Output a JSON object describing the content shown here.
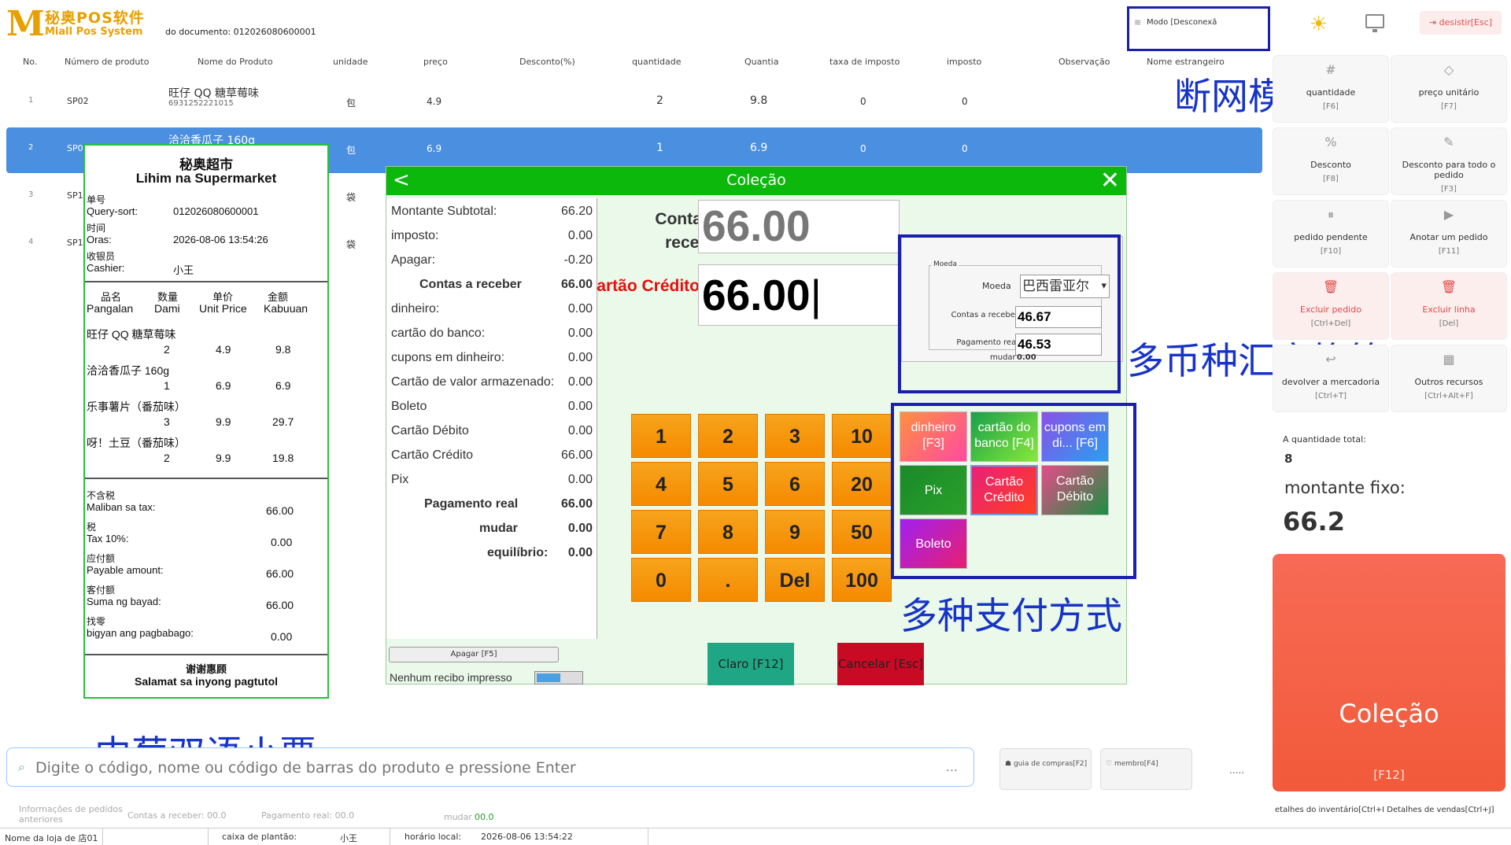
{
  "app": {
    "logo_mark": "M",
    "logo_cn": "秘奥POS软件",
    "logo_en": "Miall Pos System",
    "doc_label": "do documento: 012026080600001"
  },
  "header": {
    "mode": "Modo [Desconexã",
    "exit": "desistir[Esc]"
  },
  "annotations": {
    "offline": "断网模式",
    "currency": "多币种汇率换算",
    "payments": "多种支付方式",
    "receipt": "中葡双语小票"
  },
  "table": {
    "columns": [
      "No.",
      "Número de produto",
      "Nome do Produto",
      "unidade",
      "preço",
      "Desconto(%)",
      "quantidade",
      "Quantia",
      "taxa de imposto",
      "imposto",
      "Observação",
      "Nome estrangeiro"
    ],
    "rows": [
      {
        "no": "1",
        "code": "SP02",
        "name": "旺仔 QQ 糖草莓味",
        "barcode": "6931252221015",
        "unit": "包",
        "price": "4.9",
        "qty": "2",
        "amount": "9.8",
        "rate": "0",
        "tax": "0"
      },
      {
        "no": "2",
        "code": "SP0",
        "name": "洽洽香瓜子 160g",
        "barcode": "",
        "unit": "包",
        "price": "6.9",
        "qty": "1",
        "amount": "6.9",
        "rate": "0",
        "tax": "0"
      },
      {
        "no": "3",
        "code": "SP1",
        "name": "",
        "barcode": "",
        "unit": "袋",
        "price": "",
        "qty": "",
        "amount": "",
        "rate": "",
        "tax": ""
      },
      {
        "no": "4",
        "code": "SP1",
        "name": "",
        "barcode": "",
        "unit": "袋",
        "price": "",
        "qty": "",
        "amount": "",
        "rate": "",
        "tax": ""
      }
    ]
  },
  "right_panel": {
    "buttons": [
      {
        "icon": "#",
        "label": "quantidade",
        "key": "[F6]"
      },
      {
        "icon": "◇",
        "label": "preço unitário",
        "key": "[F7]"
      },
      {
        "icon": "%",
        "label": "Desconto",
        "key": "[F8]"
      },
      {
        "icon": "✎",
        "label": "Desconto para todo o pedido",
        "key": "[F3]"
      },
      {
        "icon": "⏸",
        "label": "pedido pendente",
        "key": "[F10]"
      },
      {
        "icon": "▶",
        "label": "Anotar um pedido",
        "key": "[F11]"
      },
      {
        "icon": "🗑",
        "label": "Excluir pedido",
        "key": "[Ctrl+Del]"
      },
      {
        "icon": "🗑",
        "label": "Excluir linha",
        "key": "[Del]"
      },
      {
        "icon": "↩",
        "label": "devolver a mercadoria",
        "key": "[Ctrl+T]"
      },
      {
        "icon": "▦",
        "label": "Outros recursos",
        "key": "[Ctrl+Alt+F]"
      }
    ],
    "qty_label": "A quantidade total:",
    "qty_value": "8",
    "fixed_label": "montante fixo:",
    "fixed_value": "66.2",
    "collect_label": "Coleção",
    "collect_key": "[F12]"
  },
  "receipt": {
    "store_cn": "秘奥超市",
    "store_en": "Lihim na Supermarket",
    "meta": [
      {
        "cn": "单号",
        "en": "Query-sort:",
        "val": "012026080600001"
      },
      {
        "cn": "时间",
        "en": "Oras:",
        "val": "2026-08-06 13:54:26"
      },
      {
        "cn": "收银员",
        "en": "Cashier:",
        "val": "小王"
      }
    ],
    "headers_cn": [
      "品名",
      "数量",
      "单价",
      "金额"
    ],
    "headers_en": [
      "Pangalan",
      "Dami",
      "Unit Price",
      "Kabuuan"
    ],
    "items": [
      {
        "name": "旺仔 QQ 糖草莓味",
        "qty": "2",
        "price": "4.9",
        "total": "9.8"
      },
      {
        "name": "洽洽香瓜子 160g",
        "qty": "1",
        "price": "6.9",
        "total": "6.9"
      },
      {
        "name": "乐事薯片（番茄味）",
        "qty": "3",
        "price": "9.9",
        "total": "29.7"
      },
      {
        "name": "呀！土豆（番茄味）",
        "qty": "2",
        "price": "9.9",
        "total": "19.8"
      }
    ],
    "totals": [
      {
        "cn": "不含税",
        "en": "Maliban sa tax:",
        "val": "66.00"
      },
      {
        "cn": "税",
        "en": "Tax 10%:",
        "val": "0.00"
      },
      {
        "cn": "应付额",
        "en": "Payable amount:",
        "val": "66.00"
      },
      {
        "cn": "客付额",
        "en": "Suma ng bayad:",
        "val": "66.00"
      },
      {
        "cn": "找零",
        "en": "bigyan ang pagbabago:",
        "val": "0.00"
      }
    ],
    "thanks_cn": "谢谢惠顾",
    "thanks_en": "Salamat sa inyong pagtutol"
  },
  "dialog": {
    "title": "Coleção",
    "summary": [
      {
        "l": "Montante Subtotal:",
        "v": "66.20",
        "b": false
      },
      {
        "l": "imposto:",
        "v": "0.00",
        "b": false
      },
      {
        "l": "Apagar:",
        "v": "-0.20",
        "b": false
      },
      {
        "l": "Contas a receber",
        "v": "66.00",
        "b": true
      },
      {
        "l": "dinheiro:",
        "v": "0.00",
        "b": false
      },
      {
        "l": "cartão do banco:",
        "v": "0.00",
        "b": false
      },
      {
        "l": "cupons em dinheiro:",
        "v": "0.00",
        "b": false
      },
      {
        "l": "Cartão de valor armazenado:",
        "v": "0.00",
        "b": false
      },
      {
        "l": "Boleto",
        "v": "0.00",
        "b": false
      },
      {
        "l": "Cartão Débito",
        "v": "0.00",
        "b": false
      },
      {
        "l": "Cartão Crédito",
        "v": "66.00",
        "b": false
      },
      {
        "l": "Pix",
        "v": "0.00",
        "b": false
      },
      {
        "l": "Pagamento real",
        "v": "66.00",
        "b": true
      },
      {
        "l": "mudar",
        "v": "0.00",
        "b": true
      },
      {
        "l": "equilíbrio:",
        "v": "0.00",
        "b": true
      }
    ],
    "clear_small": "Apagar [F5]",
    "no_receipt": "Nenhum recibo impresso",
    "contas_label": "Contas a receber",
    "contas_value": "66.00",
    "cc_label": "Cartão Crédito",
    "cc_value": "66.00",
    "currency": {
      "group": "Moeda",
      "moeda_label": "Moeda",
      "moeda_value": "巴西雷亚尔",
      "contas_label": "Contas a receber",
      "contas_value": "46.67",
      "pag_label": "Pagamento real",
      "pag_value": "46.53",
      "mudar_label": "mudar",
      "mudar_value": "0.00"
    },
    "keys": [
      "1",
      "2",
      "3",
      "10",
      "4",
      "5",
      "6",
      "20",
      "7",
      "8",
      "9",
      "50",
      "0",
      ".",
      "Del",
      "100"
    ],
    "payments": [
      {
        "label": "dinheiro [F3]",
        "bg": "linear-gradient(135deg,#ff9040,#ff4aa0)"
      },
      {
        "label": "cartão do banco [F4]",
        "bg": "linear-gradient(135deg,#18a04a,#88e83a)"
      },
      {
        "label": "cupons em di... [F6]",
        "bg": "linear-gradient(135deg,#8a50e8,#2a9ef0)"
      },
      {
        "label": "Pix",
        "bg": "linear-gradient(135deg,#1a8a2a,#2aa02a)"
      },
      {
        "label": "Cartão Crédito",
        "bg": "linear-gradient(135deg,#e8207a,#ff4020)"
      },
      {
        "label": "Cartão Débito",
        "bg": "linear-gradient(135deg,#e84a8a,#1a9040)"
      },
      {
        "label": "Boleto",
        "bg": "linear-gradient(135deg,#a020f0,#e82070)"
      }
    ],
    "claro": "Claro [F12]",
    "cancel": "Cancelar [Esc]"
  },
  "bottom": {
    "search_placeholder": "Digite o código, nome ou código de barras do produto e pressione Enter",
    "search_more": "...",
    "guide": "guia de compras[F2]",
    "member": "membro[F4]",
    "more": ".....",
    "order_info": "Informações de pedidos anteriores",
    "contas": "Contas a receber: 00.0",
    "pagamento": "Pagamento real: 00.0",
    "mudar_label": "mudar",
    "mudar_value": "00.0",
    "stock": "etalhes do inventário[Ctrl+I  Detalhes de vendas[Ctrl+J]"
  },
  "status": {
    "store": "Nome da loja de 店01",
    "shift_label": "caixa de plantão:",
    "shift_value": "小王",
    "time_label": "horário local:",
    "time_value": "2026-08-06 13:54:22"
  }
}
